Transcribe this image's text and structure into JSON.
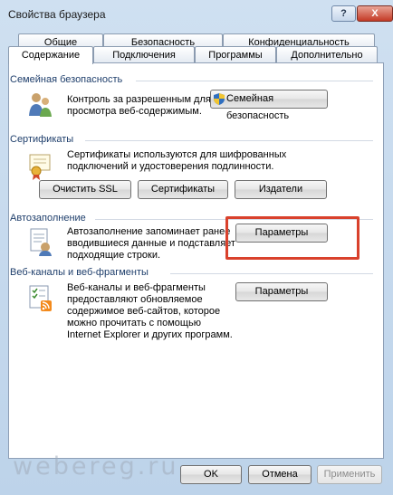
{
  "window": {
    "title": "Свойства браузера",
    "help": "?",
    "close": "X"
  },
  "tabs_back": [
    "Общие",
    "Безопасность",
    "Конфиденциальность"
  ],
  "tabs_front": [
    "Содержание",
    "Подключения",
    "Программы",
    "Дополнительно"
  ],
  "groups": {
    "family": {
      "title": "Семейная безопасность",
      "desc1": "Контроль за разрешенным для",
      "desc2": "просмотра веб-содержимым.",
      "button": "Семейная безопасность"
    },
    "certs": {
      "title": "Сертификаты",
      "desc1": "Сертификаты используются для шифрованных",
      "desc2": "подключений и удостоверения подлинности.",
      "btn_ssl": "Очистить SSL",
      "btn_certs": "Сертификаты",
      "btn_publishers": "Издатели"
    },
    "autofill": {
      "title": "Автозаполнение",
      "desc1": "Автозаполнение запоминает ранее",
      "desc2": "вводившиеся данные и подставляет",
      "desc3": "подходящие строки.",
      "button": "Параметры"
    },
    "feeds": {
      "title": "Веб-каналы и веб-фрагменты",
      "desc1": "Веб-каналы и веб-фрагменты",
      "desc2": "предоставляют обновляемое",
      "desc3": "содержимое веб-сайтов, которое",
      "desc4": "можно прочитать с помощью",
      "desc5": "Internet Explorer и других программ.",
      "button": "Параметры"
    }
  },
  "footer": {
    "ok": "OK",
    "cancel": "Отмена",
    "apply": "Применить"
  },
  "watermark": "webereg.ru"
}
